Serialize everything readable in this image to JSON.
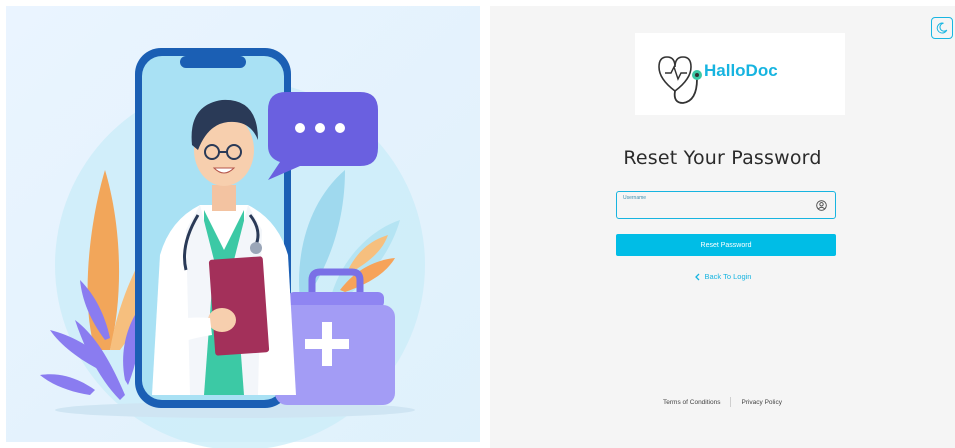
{
  "brand": {
    "name": "HalloDoc",
    "color": "#17b4e0"
  },
  "form": {
    "title": "Reset Your Password",
    "username_label": "Username",
    "username_value": "",
    "submit_label": "Reset Password",
    "back_label": "Back To Login"
  },
  "footer": {
    "terms_label": "Terms of Conditions",
    "privacy_label": "Privacy Policy"
  },
  "icons": {
    "theme_toggle": "moon-icon",
    "username": "user-circle-icon",
    "back": "chevron-left-icon"
  },
  "colors": {
    "accent": "#00bde6",
    "panel_bg": "#f5f5f5"
  }
}
